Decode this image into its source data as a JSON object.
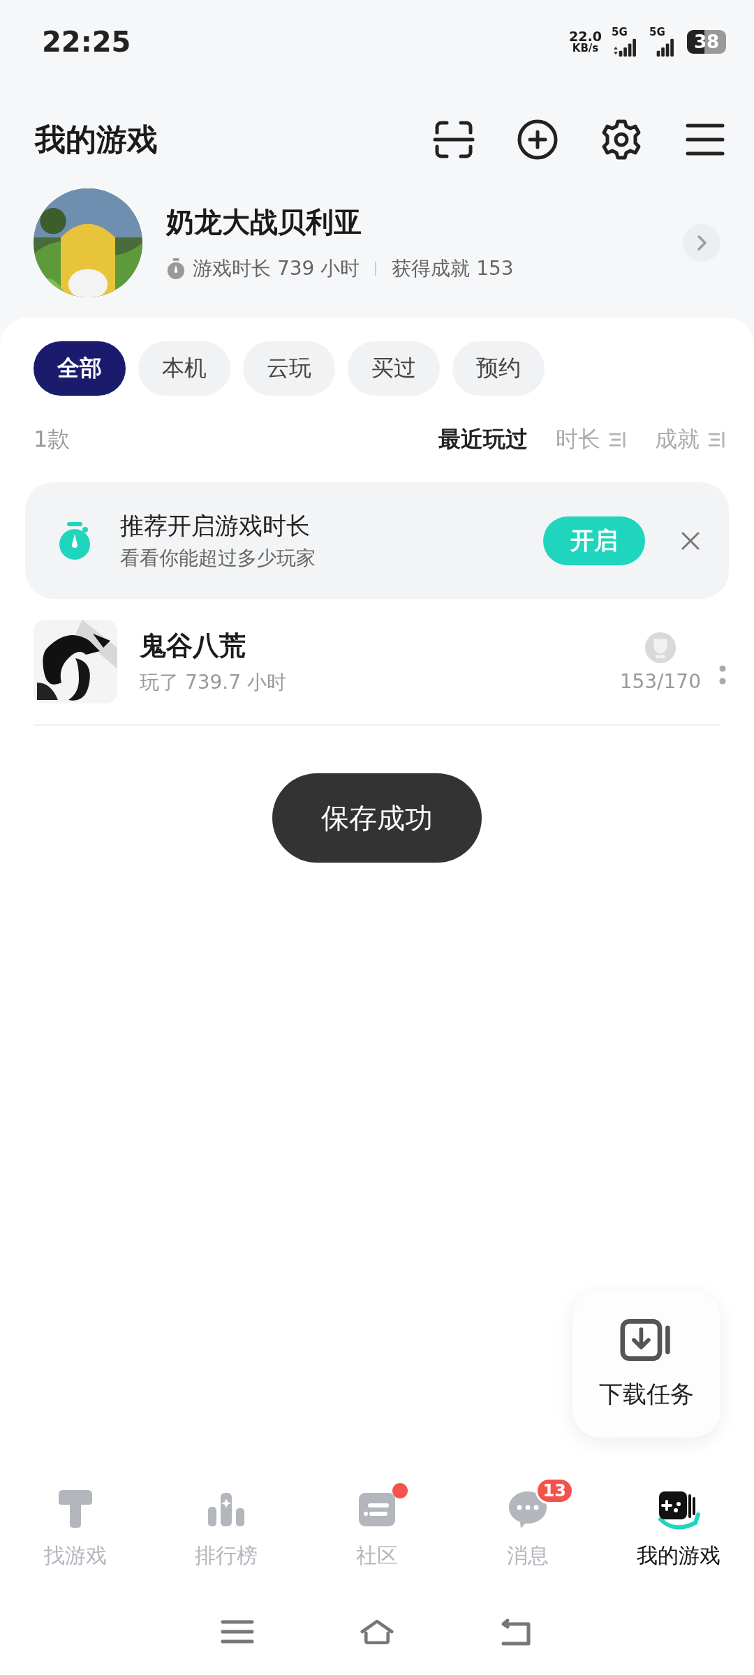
{
  "status_bar": {
    "time": "22:25",
    "net_speed": "22.0",
    "net_speed_unit": "KB/s",
    "sim_labels": [
      "5G",
      "5G"
    ],
    "battery": "38"
  },
  "header": {
    "title": "我的游戏"
  },
  "profile": {
    "name": "奶龙大战贝利亚",
    "playtime": "游戏时长 739 小时",
    "achievements": "获得成就 153"
  },
  "filter_tabs": [
    {
      "label": "全部",
      "selected": true
    },
    {
      "label": "本机",
      "selected": false
    },
    {
      "label": "云玩",
      "selected": false
    },
    {
      "label": "买过",
      "selected": false
    },
    {
      "label": "预约",
      "selected": false
    }
  ],
  "list_bar": {
    "count": "1款",
    "sorts": [
      {
        "label": "最近玩过",
        "selected": true,
        "sortable": false
      },
      {
        "label": "时长",
        "selected": false,
        "sortable": true
      },
      {
        "label": "成就",
        "selected": false,
        "sortable": true
      }
    ]
  },
  "banner": {
    "title": "推荐开启游戏时长",
    "subtitle": "看看你能超过多少玩家",
    "button": "开启"
  },
  "games": [
    {
      "name": "鬼谷八荒",
      "playtime": "玩了 739.7 小时",
      "achievements": "153/170"
    }
  ],
  "toast": "保存成功",
  "download_button": {
    "label": "下载任务"
  },
  "bottom_nav": [
    {
      "label": "找游戏",
      "selected": false
    },
    {
      "label": "排行榜",
      "selected": false
    },
    {
      "label": "社区",
      "selected": false,
      "dot": true
    },
    {
      "label": "消息",
      "selected": false,
      "badge": "13"
    },
    {
      "label": "我的游戏",
      "selected": true
    }
  ]
}
